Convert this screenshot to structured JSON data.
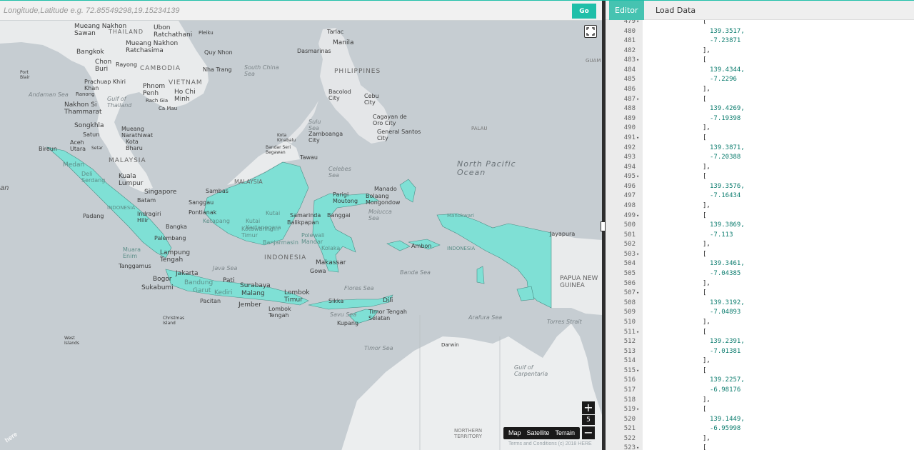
{
  "search": {
    "placeholder": "Longitude,Latitude e.g. 72.85549298,19.15234139",
    "value": "",
    "go_label": "Go"
  },
  "map": {
    "accent": "#1fbfa9",
    "highlight_fill": "#7fe0d5",
    "zoom_in_label": "+",
    "zoom_out_label": "−",
    "zoom_level": "5",
    "map_types": [
      "Map",
      "Satellite",
      "Terrain"
    ],
    "terms": "Terms and Conditions  (c) 2018 HERE",
    "logo": "here",
    "labels": {
      "thailand": "THAILAND",
      "mueang_nakhon_sawan": "Mueang Nakhon Sawan",
      "ubon": "Ubon Ratchathani",
      "mueang_nakhon_ratchasima": "Mueang Nakhon Ratchasima",
      "bangkok": "Bangkok",
      "pleiku": "Pleiku",
      "quy_nhon": "Quy Nhon",
      "tarlac": "Tarlac",
      "manila": "Manila",
      "dasmarinas": "Dasmarinas",
      "chon_buri": "Chon Buri",
      "rayong": "Rayong",
      "cambodia": "CAMBODIA",
      "buon_ma_thuot": "Buon Ma Thuot",
      "da_lat": "Da Lat",
      "nha_trang": "Nha Trang",
      "south_china_sea": "South China Sea",
      "philippines": "PHILIPPINES",
      "port_blair": "Port Blair",
      "prachuap": "Prachuap Khiri Khan",
      "phnom_penh": "Phnom Penh",
      "vietnam": "VIETNAM",
      "andaman_sea": "Andaman Sea",
      "ranong": "Ranong",
      "gulf_of_thailand": "Gulf of Thailand",
      "ho_chi_minh": "Ho Chi Minh",
      "rach_gia": "Rach Gia",
      "ca_mau": "Ca Mau",
      "bacolod": "Bacolod City",
      "cebu": "Cebu City",
      "guam": "GUAM",
      "nakhon_si_thammarat": "Nakhon Si Thammarat",
      "sulu_sea": "Sulu Sea",
      "cagayan": "Cagayan de Oro City",
      "songkhla": "Songkhla",
      "mueang_narathiwat": "Mueang Narathiwat",
      "satun": "Satun",
      "zamboanga": "Zamboanga City",
      "general_santos": "General Santos City",
      "palau": "PALAU",
      "aceh_utara": "Aceh Utara",
      "kota_bharu": "Kota Bharu",
      "setar": "Setar",
      "kota_kinabalu": "Kota Kinabalu",
      "bandar_seri_begawan": "Bandar Seri Begawan",
      "bireun": "Bireun",
      "malaysia_west": "MALAYSIA",
      "tawau": "Tawau",
      "medan": "Medan",
      "north_pacific": "North Pacific Ocean",
      "deli_serdang": "Deli Serdang",
      "kuala_lumpur": "Kuala Lumpur",
      "celebes_sea": "Celebes Sea",
      "malaysia_east": "MALAYSIA",
      "singapore": "Singapore",
      "batam": "Batam",
      "manado": "Manado",
      "bolaang": "Bolaang Mongondow",
      "parigi": "Parigi Moutong",
      "sambas": "Sambas",
      "sanggau": "Sanggau",
      "indonesia_small": "INDONESIA",
      "ponianak": "Pontianak",
      "ketapang": "Ketapang",
      "indragiri": "Indragiri Hilir",
      "padang": "Padang",
      "kutai": "Kutai",
      "samarinda": "Samarinda",
      "balikpapan": "Balikpapan",
      "banggai": "Banggai",
      "molucca_sea": "Molucca Sea",
      "manokwari": "Manokwari",
      "bangka": "Bangka",
      "palembang": "Palembang",
      "kotawaringin": "Kotawaringin Timur",
      "kutai_kartanegara": "Kutai Kartanegara",
      "jayapura": "Jayapura",
      "polewali": "Polewali Mandar",
      "ambon": "Ambon",
      "indonesia_east": "INDONESIA",
      "banjarmasin": "Banjarmasin",
      "kolaka": "Kolaka",
      "muara": "Muara Enim",
      "lampung": "Lampung Tengah",
      "indonesia_main": "INDONESIA",
      "makassar": "Makassar",
      "java_sea": "Java Sea",
      "tanggamus": "Tanggamus",
      "gowa": "Gowa",
      "banda_sea": "Banda Sea",
      "papua_new_guinea": "PAPUA NEW GUINEA",
      "bogor": "Bogor",
      "jakarta": "Jakarta",
      "sukabumi": "Sukabumi",
      "pati": "Pati",
      "surabaya": "Surabaya",
      "bandung": "Bandung",
      "garut": "Garut",
      "kediri": "Kediri",
      "malang": "Malang",
      "lombok_timur": "Lombok Timur",
      "flores_sea": "Flores Sea",
      "dili": "Dili",
      "pacitan": "Pacitan",
      "jember": "Jember",
      "lombok_tengah": "Lombok Tengah",
      "sikka": "Sikka",
      "timor_tengah": "Timor Tengah Selatan",
      "christmas_island": "Christmas Island",
      "savu_sea": "Savu Sea",
      "kupang": "Kupang",
      "arafura_sea": "Arafura Sea",
      "torres_strait": "Torres Strait",
      "west_islands": "West Islands",
      "timor_sea": "Timor Sea",
      "darwin": "Darwin",
      "gulf_carpentaria": "Gulf of Carpentaria",
      "northern_territory": "NORTHERN TERRITORY",
      "left_edge": "an"
    }
  },
  "editor": {
    "tabs": [
      "Editor",
      "Load Data"
    ],
    "active_tab": "Editor",
    "lines": [
      {
        "n": "479",
        "fold": true,
        "text": "["
      },
      {
        "n": "480",
        "fold": false,
        "text": "139.3517,"
      },
      {
        "n": "481",
        "fold": false,
        "text": "-7.23871"
      },
      {
        "n": "482",
        "fold": false,
        "text": "],"
      },
      {
        "n": "483",
        "fold": true,
        "text": "["
      },
      {
        "n": "484",
        "fold": false,
        "text": "139.4344,"
      },
      {
        "n": "485",
        "fold": false,
        "text": "-7.2296"
      },
      {
        "n": "486",
        "fold": false,
        "text": "],"
      },
      {
        "n": "487",
        "fold": true,
        "text": "["
      },
      {
        "n": "488",
        "fold": false,
        "text": "139.4269,"
      },
      {
        "n": "489",
        "fold": false,
        "text": "-7.19398"
      },
      {
        "n": "490",
        "fold": false,
        "text": "],"
      },
      {
        "n": "491",
        "fold": true,
        "text": "["
      },
      {
        "n": "492",
        "fold": false,
        "text": "139.3871,"
      },
      {
        "n": "493",
        "fold": false,
        "text": "-7.20388"
      },
      {
        "n": "494",
        "fold": false,
        "text": "],"
      },
      {
        "n": "495",
        "fold": true,
        "text": "["
      },
      {
        "n": "496",
        "fold": false,
        "text": "139.3576,"
      },
      {
        "n": "497",
        "fold": false,
        "text": "-7.16434"
      },
      {
        "n": "498",
        "fold": false,
        "text": "],"
      },
      {
        "n": "499",
        "fold": true,
        "text": "["
      },
      {
        "n": "500",
        "fold": false,
        "text": "139.3869,"
      },
      {
        "n": "501",
        "fold": false,
        "text": "-7.113"
      },
      {
        "n": "502",
        "fold": false,
        "text": "],"
      },
      {
        "n": "503",
        "fold": true,
        "text": "["
      },
      {
        "n": "504",
        "fold": false,
        "text": "139.3461,"
      },
      {
        "n": "505",
        "fold": false,
        "text": "-7.04385"
      },
      {
        "n": "506",
        "fold": false,
        "text": "],"
      },
      {
        "n": "507",
        "fold": true,
        "text": "["
      },
      {
        "n": "508",
        "fold": false,
        "text": "139.3192,"
      },
      {
        "n": "509",
        "fold": false,
        "text": "-7.04893"
      },
      {
        "n": "510",
        "fold": false,
        "text": "],"
      },
      {
        "n": "511",
        "fold": true,
        "text": "["
      },
      {
        "n": "512",
        "fold": false,
        "text": "139.2391,"
      },
      {
        "n": "513",
        "fold": false,
        "text": "-7.01381"
      },
      {
        "n": "514",
        "fold": false,
        "text": "],"
      },
      {
        "n": "515",
        "fold": true,
        "text": "["
      },
      {
        "n": "516",
        "fold": false,
        "text": "139.2257,"
      },
      {
        "n": "517",
        "fold": false,
        "text": "-6.98176"
      },
      {
        "n": "518",
        "fold": false,
        "text": "],"
      },
      {
        "n": "519",
        "fold": true,
        "text": "["
      },
      {
        "n": "520",
        "fold": false,
        "text": "139.1449,"
      },
      {
        "n": "521",
        "fold": false,
        "text": "-6.95998"
      },
      {
        "n": "522",
        "fold": false,
        "text": "],"
      },
      {
        "n": "523",
        "fold": true,
        "text": "["
      }
    ]
  }
}
